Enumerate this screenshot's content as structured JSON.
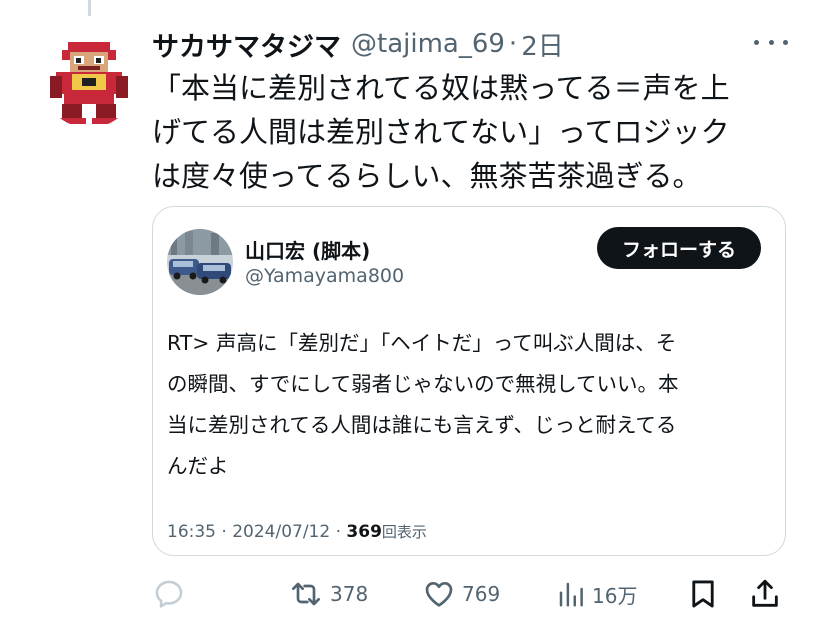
{
  "colors": {
    "text": "#0f1419",
    "secondary": "#536471",
    "border": "#cfd9de",
    "button_bg": "#0f1419",
    "button_text": "#ffffff"
  },
  "tweet": {
    "author_name": "サカサマタジマ",
    "author_handle": "@tajima_69",
    "separator": "·",
    "time": "2日",
    "text": "「本当に差別されてる奴は黙ってる＝声を上\nげてる人間は差別されてない」ってロジック\nは度々使ってるらしい、無茶苦茶過ぎる。",
    "avatar_icon": "pixel-robot-avatar",
    "more_icon": "more-dots-icon"
  },
  "quote": {
    "author_name": "山口宏 (脚本)",
    "author_handle": "@Yamayama800",
    "follow_label": "フォローする",
    "avatar_icon": "cars-photo-avatar",
    "text": "RT> 声高に「差別だ」「ヘイトだ」って叫ぶ人間は、そ\nの瞬間、すでにして弱者じゃないので無視していい。本\n当に差別されてる人間は誰にも言えず、じっと耐えてる\nんだよ",
    "timestamp": "16:35 · 2024/07/12 · ",
    "views_count": "369",
    "views_label": "回表示"
  },
  "actions": {
    "reply_icon": "reply-bubble-icon",
    "retweet_icon": "retweet-icon",
    "retweets": "378",
    "like_icon": "heart-icon",
    "likes": "769",
    "views_icon": "bar-chart-icon",
    "views": "16万",
    "bookmark_icon": "bookmark-icon",
    "share_icon": "share-icon"
  }
}
